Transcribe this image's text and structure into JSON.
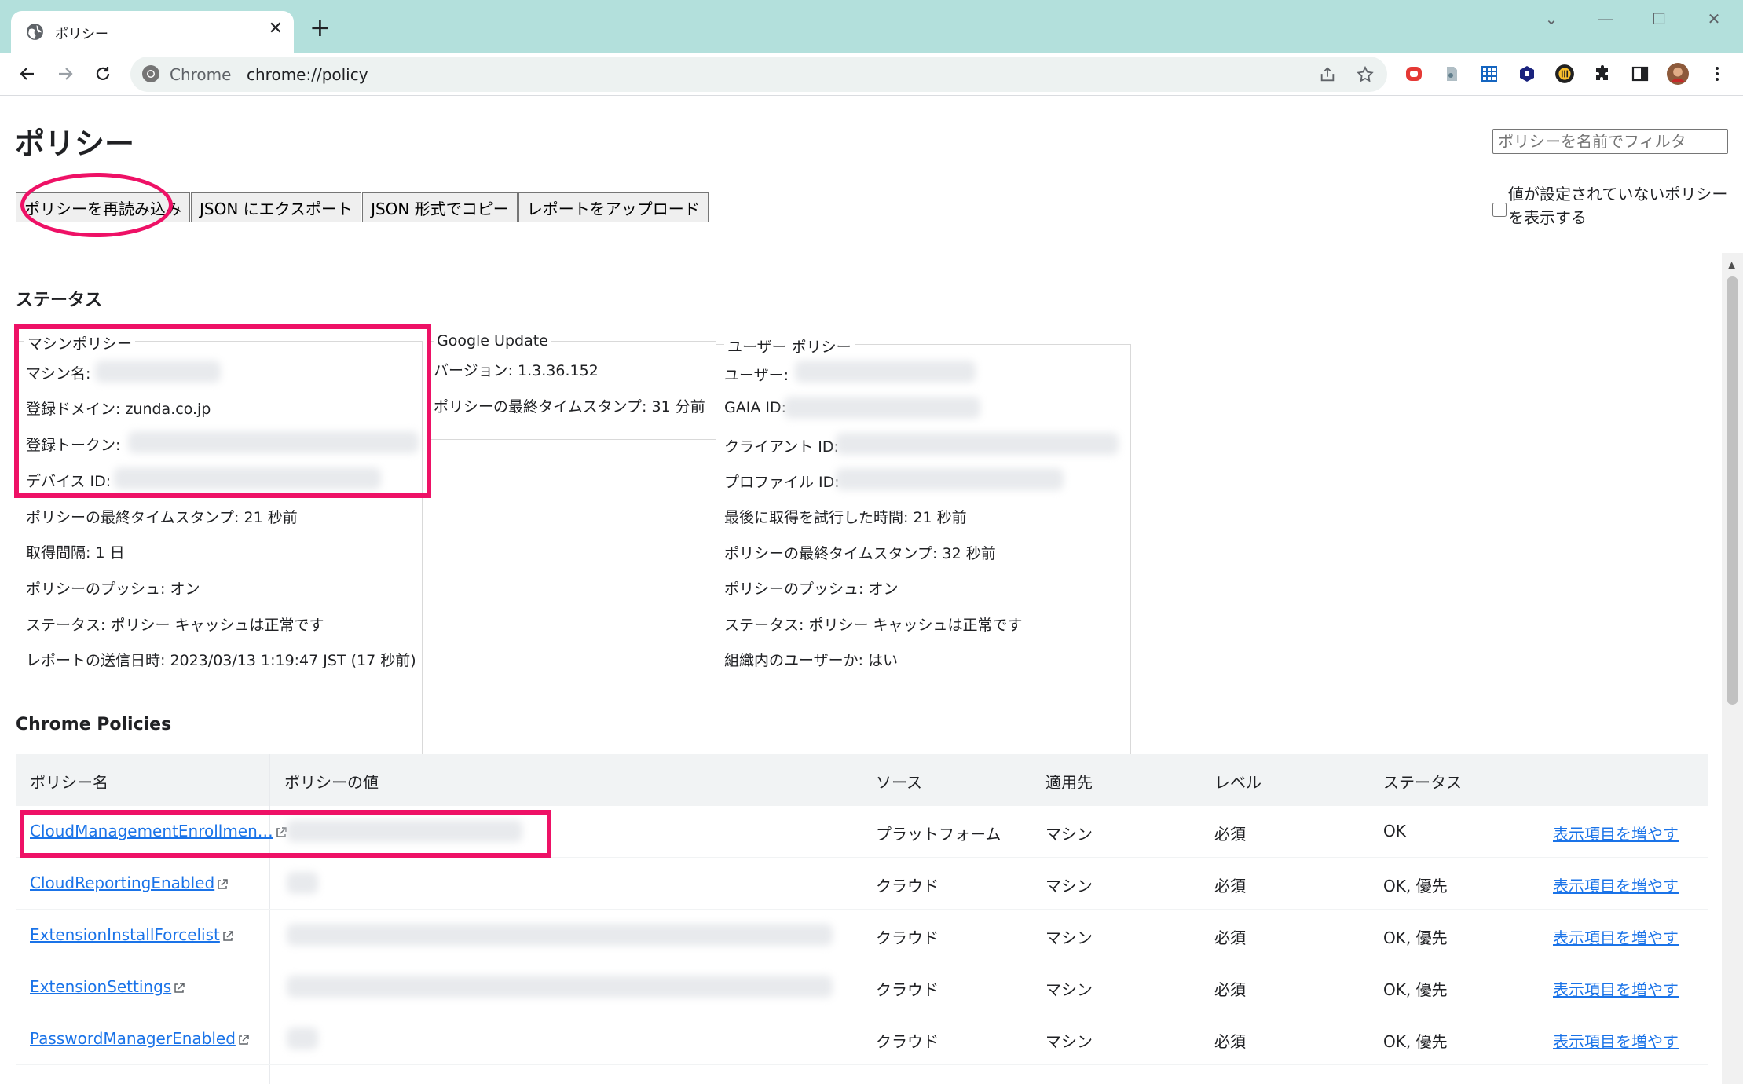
{
  "browser": {
    "tab_title": "ポリシー",
    "omnibox_prefix": "Chrome",
    "url": "chrome://policy"
  },
  "page": {
    "title": "ポリシー",
    "filter_placeholder": "ポリシーを名前でフィルタ",
    "buttons": {
      "reload": "ポリシーを再読み込み",
      "export_json": "JSON にエクスポート",
      "copy_json": "JSON 形式でコピー",
      "upload_report": "レポートをアップロード"
    },
    "show_unset_label": "値が設定されていないポリシーを表示する",
    "status_title": "ステータス",
    "policies_title": "Chrome Policies"
  },
  "machine_policy": {
    "legend": "マシンポリシー",
    "machine_name": "マシン名:",
    "domain": "登録ドメイン: zunda.co.jp",
    "token": "登録トークン:",
    "device_id": "デバイス ID:",
    "timestamp": "ポリシーの最終タイムスタンプ: 21 秒前",
    "interval": "取得間隔: 1 日",
    "push": "ポリシーのプッシュ: オン",
    "status": "ステータス: ポリシー キャッシュは正常です",
    "report_sent": "レポートの送信日時: 2023/03/13 1:19:47 JST (17 秒前)"
  },
  "google_update": {
    "legend": "Google Update",
    "version": "バージョン: 1.3.36.152",
    "timestamp": "ポリシーの最終タイムスタンプ: 31 分前"
  },
  "user_policy": {
    "legend": "ユーザー ポリシー",
    "user": "ユーザー:",
    "gaia_id": "GAIA ID:",
    "client_id": "クライアント ID:",
    "profile_id": "プロファイル ID:",
    "last_fetch": "最後に取得を試行した時間: 21 秒前",
    "timestamp": "ポリシーの最終タイムスタンプ: 32 秒前",
    "push": "ポリシーのプッシュ: オン",
    "status": "ステータス: ポリシー キャッシュは正常です",
    "in_org": "組織内のユーザーか: はい"
  },
  "table": {
    "headers": {
      "name": "ポリシー名",
      "value": "ポリシーの値",
      "source": "ソース",
      "scope": "適用先",
      "level": "レベル",
      "status": "ステータス"
    },
    "rows": [
      {
        "name": "CloudManagementEnrollmen…",
        "source": "プラットフォーム",
        "scope": "マシン",
        "level": "必須",
        "status": "OK",
        "more": "表示項目を増やす"
      },
      {
        "name": "CloudReportingEnabled",
        "source": "クラウド",
        "scope": "マシン",
        "level": "必須",
        "status": "OK, 優先",
        "more": "表示項目を増やす"
      },
      {
        "name": "ExtensionInstallForcelist",
        "source": "クラウド",
        "scope": "マシン",
        "level": "必須",
        "status": "OK, 優先",
        "more": "表示項目を増やす"
      },
      {
        "name": "ExtensionSettings",
        "source": "クラウド",
        "scope": "マシン",
        "level": "必須",
        "status": "OK, 優先",
        "more": "表示項目を増やす"
      },
      {
        "name": "PasswordManagerEnabled",
        "source": "クラウド",
        "scope": "マシン",
        "level": "必須",
        "status": "OK, 優先",
        "more": "表示項目を増やす"
      }
    ]
  },
  "colors": {
    "annotation": "#ee1166",
    "link": "#1a73e8",
    "titlebar": "#b3e0dc"
  }
}
